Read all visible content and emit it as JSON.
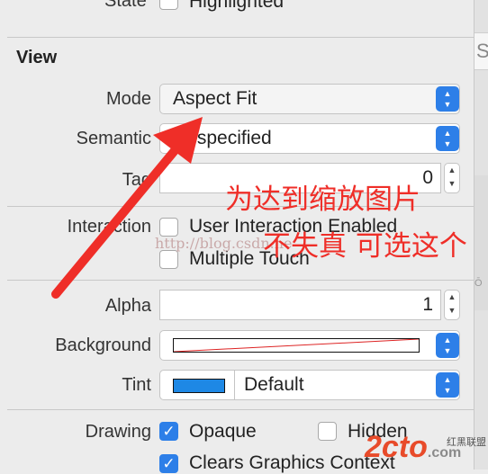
{
  "top": {
    "state_label": "State",
    "highlighted": "Highlighted"
  },
  "view_section": {
    "title": "View"
  },
  "mode": {
    "label": "Mode",
    "value": "Aspect Fit"
  },
  "semantic": {
    "label": "Semantic",
    "value": "Unspecified"
  },
  "tag": {
    "label": "Tag",
    "value": "0"
  },
  "interaction": {
    "label": "Interaction",
    "user_interaction": "User Interaction Enabled",
    "multiple_touch": "Multiple Touch"
  },
  "alpha": {
    "label": "Alpha",
    "value": "1"
  },
  "background": {
    "label": "Background"
  },
  "tint": {
    "label": "Tint",
    "value": "Default",
    "swatch": "#1e88e5"
  },
  "drawing": {
    "label": "Drawing",
    "opaque": "Opaque",
    "hidden": "Hidden",
    "clears": "Clears Graphics Context"
  },
  "annotation": {
    "line1": "为达到缩放图片",
    "line2": "不失真 可选这个",
    "color": "#ef2e28"
  },
  "watermark": {
    "url": "http://blog.csdn.ne",
    "logo": "2cto",
    "logo_suffix": ".com",
    "site": "红黑联盟"
  }
}
